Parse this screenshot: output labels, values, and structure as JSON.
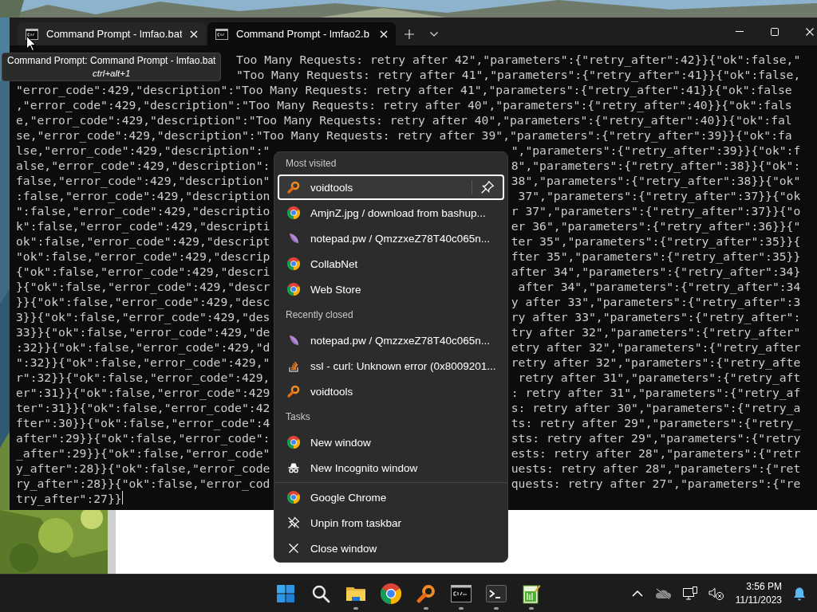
{
  "terminal": {
    "tabs": [
      {
        "title": "Command Prompt - lmfao.bat",
        "selected": false
      },
      {
        "title": "Command Prompt - lmfao2.b",
        "selected": true
      }
    ],
    "tooltip": {
      "title": "Command Prompt: Command Prompt - lmfao.bat",
      "shortcut": "ctrl+alt+1"
    },
    "cursor": true,
    "rows": [
      {
        "right": "Too Many Requests: retry after 42\",\"parameters\":{\"retry_after\":42}}{\"ok\":false,\""
      },
      {
        "right": "\"Too Many Requests: retry after 41\",\"parameters\":{\"retry_after\":41}}{\"ok\":false,"
      },
      {
        "left": "\"error_code\":429,\"description\":\"Too Many Requests: retry after 41\",\"parameters\":{\"retry_after\":41}}{\"ok\":false"
      },
      {
        "left": ",\"error_code\":429,\"description\":\"Too Many Requests: retry after 40\",\"parameters\":{\"retry_after\":40}}{\"ok\":fals"
      },
      {
        "left": "e,\"error_code\":429,\"description\":\"Too Many Requests: retry after 40\",\"parameters\":{\"retry_after\":40}}{\"ok\":fal"
      },
      {
        "left": "se,\"error_code\":429,\"description\":\"Too Many Requests: retry after 39\",\"parameters\":{\"retry_after\":39}}{\"ok\":fa"
      },
      {
        "left": "lse,\"error_code\":429,\"description\":\"",
        "right": "\",\"parameters\":{\"retry_after\":39}}{\"ok\":f"
      },
      {
        "left": "alse,\"error_code\":429,\"description\":",
        "right": "8\",\"parameters\":{\"retry_after\":38}}{\"ok\":"
      },
      {
        "left": "false,\"error_code\":429,\"description\"",
        "right": "38\",\"parameters\":{\"retry_after\":38}}{\"ok\""
      },
      {
        "left": ":false,\"error_code\":429,\"description",
        "right": "37\",\"parameters\":{\"retry_after\":37}}{\"ok"
      },
      {
        "left": "\":false,\"error_code\":429,\"descriptio",
        "right": "r 37\",\"parameters\":{\"retry_after\":37}}{\"o"
      },
      {
        "left": "k\":false,\"error_code\":429,\"descripti",
        "right": "er 36\",\"parameters\":{\"retry_after\":36}}{\""
      },
      {
        "left": "ok\":false,\"error_code\":429,\"descript",
        "right": "ter 35\",\"parameters\":{\"retry_after\":35}}{"
      },
      {
        "left": "\"ok\":false,\"error_code\":429,\"descrip",
        "right": "fter 35\",\"parameters\":{\"retry_after\":35}}"
      },
      {
        "left": "{\"ok\":false,\"error_code\":429,\"descri",
        "right": "after 34\",\"parameters\":{\"retry_after\":34}"
      },
      {
        "left": "}{\"ok\":false,\"error_code\":429,\"descr",
        "right": "after 34\",\"parameters\":{\"retry_after\":34"
      },
      {
        "left": "}}{\"ok\":false,\"error_code\":429,\"desc",
        "right": "y after 33\",\"parameters\":{\"retry_after\":3"
      },
      {
        "left": "3}}{\"ok\":false,\"error_code\":429,\"des",
        "right": "ry after 33\",\"parameters\":{\"retry_after\":"
      },
      {
        "left": "33}}{\"ok\":false,\"error_code\":429,\"de",
        "right": "try after 32\",\"parameters\":{\"retry_after\""
      },
      {
        "left": ":32}}{\"ok\":false,\"error_code\":429,\"d",
        "right": "etry after 32\",\"parameters\":{\"retry_after"
      },
      {
        "left": "\":32}}{\"ok\":false,\"error_code\":429,\"",
        "right": "retry after 32\",\"parameters\":{\"retry_afte"
      },
      {
        "left": "r\":32}}{\"ok\":false,\"error_code\":429,",
        "right": "retry after 31\",\"parameters\":{\"retry_aft"
      },
      {
        "left": "er\":31}}{\"ok\":false,\"error_code\":429",
        "right": ": retry after 31\",\"parameters\":{\"retry_af"
      },
      {
        "left": "ter\":31}}{\"ok\":false,\"error_code\":42",
        "right": "s: retry after 30\",\"parameters\":{\"retry_a"
      },
      {
        "left": "fter\":30}}{\"ok\":false,\"error_code\":4",
        "right": "ts: retry after 29\",\"parameters\":{\"retry_"
      },
      {
        "left": "after\":29}}{\"ok\":false,\"error_code\":",
        "right": "sts: retry after 29\",\"parameters\":{\"retry"
      },
      {
        "left": "_after\":29}}{\"ok\":false,\"error_code\"",
        "right": "ests: retry after 28\",\"parameters\":{\"retr"
      },
      {
        "left": "y_after\":28}}{\"ok\":false,\"error_code",
        "right": "uests: retry after 28\",\"parameters\":{\"ret"
      },
      {
        "left": "ry_after\":28}}{\"ok\":false,\"error_cod",
        "right": "quests: retry after 27\",\"parameters\":{\"re"
      },
      {
        "left": "try_after\":27}}"
      }
    ]
  },
  "jump_list": {
    "sections": [
      {
        "heading": "Most visited",
        "items": [
          {
            "kind": "magnifier",
            "label": "voidtools",
            "selected": true
          },
          {
            "kind": "chrome",
            "label": "AmjnZ.jpg / download from bashup...",
            "selected": false
          },
          {
            "kind": "leaf",
            "label": "notepad.pw / QmzzxeZ78T40c065n...",
            "selected": false
          },
          {
            "kind": "chrome",
            "label": "CollabNet",
            "selected": false
          },
          {
            "kind": "chrome",
            "label": "Web Store",
            "selected": false
          }
        ]
      },
      {
        "heading": "Recently closed",
        "items": [
          {
            "kind": "leaf",
            "label": "notepad.pw / QmzzxeZ78T40c065n...",
            "selected": false
          },
          {
            "kind": "stack",
            "label": "ssl - curl: Unknown error (0x8009201...",
            "selected": false
          },
          {
            "kind": "magnifier",
            "label": "voidtools",
            "selected": false
          }
        ]
      },
      {
        "heading": "Tasks",
        "items": [
          {
            "kind": "chrome",
            "label": "New window",
            "selected": false
          },
          {
            "kind": "incognito",
            "label": "New Incognito window",
            "selected": false
          }
        ]
      },
      {
        "items": [
          {
            "kind": "chrome",
            "label": "Google Chrome",
            "selected": false
          },
          {
            "kind": "unpin",
            "label": "Unpin from taskbar",
            "selected": false
          },
          {
            "kind": "close",
            "label": "Close window",
            "selected": false
          }
        ]
      }
    ]
  },
  "taskbar": {
    "apps": [
      {
        "kind": "start",
        "running": false
      },
      {
        "kind": "search",
        "running": false
      },
      {
        "kind": "folder",
        "running": true
      },
      {
        "kind": "chrome",
        "running": false
      },
      {
        "kind": "magnifier",
        "running": true
      },
      {
        "kind": "console",
        "running": true
      },
      {
        "kind": "terminal",
        "running": true
      },
      {
        "kind": "notepad",
        "running": true
      }
    ],
    "clock": {
      "time": "3:56 PM",
      "date": "11/11/2023"
    }
  }
}
